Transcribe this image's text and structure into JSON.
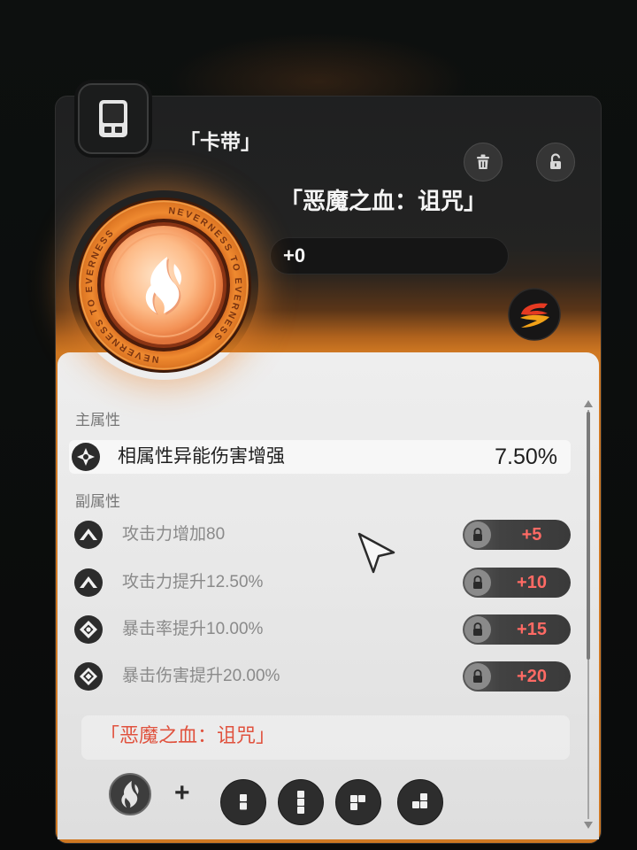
{
  "header": {
    "category_label": "「卡带」",
    "category_icon": "cassette-icon"
  },
  "toolbar": {
    "delete_icon": "trash-icon",
    "lock_icon": "unlock-icon"
  },
  "item": {
    "name": "「恶魔之血：诅咒」",
    "level": "+0",
    "emblem_text": "NEVERNESS TO EVERNESS",
    "emblem_icon": "flame-emblem-icon",
    "rank_icon": "rank-icon"
  },
  "main_stat": {
    "section_label": "主属性",
    "name": "相属性异能伤害增强",
    "value": "7.50%",
    "icon": "element-damage-icon"
  },
  "sub_stats": {
    "section_label": "副属性",
    "items": [
      {
        "name": "攻击力增加80",
        "upgrade": "+5",
        "icon": "attack-icon"
      },
      {
        "name": "攻击力提升12.50%",
        "upgrade": "+10",
        "icon": "attack-icon"
      },
      {
        "name": "暴击率提升10.00%",
        "upgrade": "+15",
        "icon": "crit-rate-icon"
      },
      {
        "name": "暴击伤害提升20.00%",
        "upgrade": "+20",
        "icon": "crit-damage-icon"
      }
    ]
  },
  "set_bonus": {
    "name": "「恶魔之血：诅咒」",
    "plus": "+",
    "pieces": [
      "set-emblem-icon",
      "piece-domino-icon",
      "piece-line-icon",
      "piece-l-icon",
      "piece-s-icon"
    ]
  },
  "colors": {
    "accent": "#e0523e",
    "orange": "#cf7822",
    "upgrade_text": "#ff6a64",
    "panel_dark": "#1f2021",
    "panel_light": "#eeeeee"
  }
}
